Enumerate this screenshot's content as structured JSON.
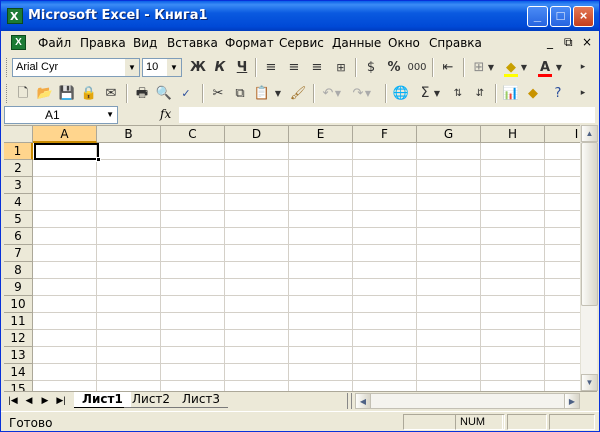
{
  "window": {
    "title": "Microsoft Excel - Книга1",
    "app_icon": "X",
    "minimize_glyph": "_",
    "maximize_glyph": "□",
    "close_glyph": "×"
  },
  "menu": {
    "items": [
      "Файл",
      "Правка",
      "Вид",
      "Вставка",
      "Формат",
      "Сервис",
      "Данные",
      "Окно",
      "Справка"
    ],
    "mdi_minimize": "_",
    "mdi_restore": "⧉",
    "mdi_close": "×"
  },
  "formatting_toolbar": {
    "font_name": "Arial Cyr",
    "font_size": "10",
    "bold_label": "Ж",
    "italic_label": "К",
    "underline_label": "Ч",
    "percent_label": "%",
    "thousands_label": "000"
  },
  "standard_toolbar": {
    "sigma_label": "Σ"
  },
  "formula_bar": {
    "name_box": "A1",
    "fx_label": "fx",
    "formula": ""
  },
  "grid": {
    "columns": [
      "A",
      "B",
      "C",
      "D",
      "E",
      "F",
      "G",
      "H",
      "I"
    ],
    "rows": [
      "1",
      "2",
      "3",
      "4",
      "5",
      "6",
      "7",
      "8",
      "9",
      "10",
      "11",
      "12",
      "13",
      "14",
      "15"
    ],
    "active_cell": "A1"
  },
  "sheets": {
    "tabs": [
      "Лист1",
      "Лист2",
      "Лист3"
    ],
    "active": "Лист1"
  },
  "status": {
    "ready": "Готово",
    "num": "NUM"
  },
  "colors": {
    "title_bar": "#0a5ae0",
    "active_header": "#ffd58d",
    "gridline": "#d4d0c8"
  }
}
